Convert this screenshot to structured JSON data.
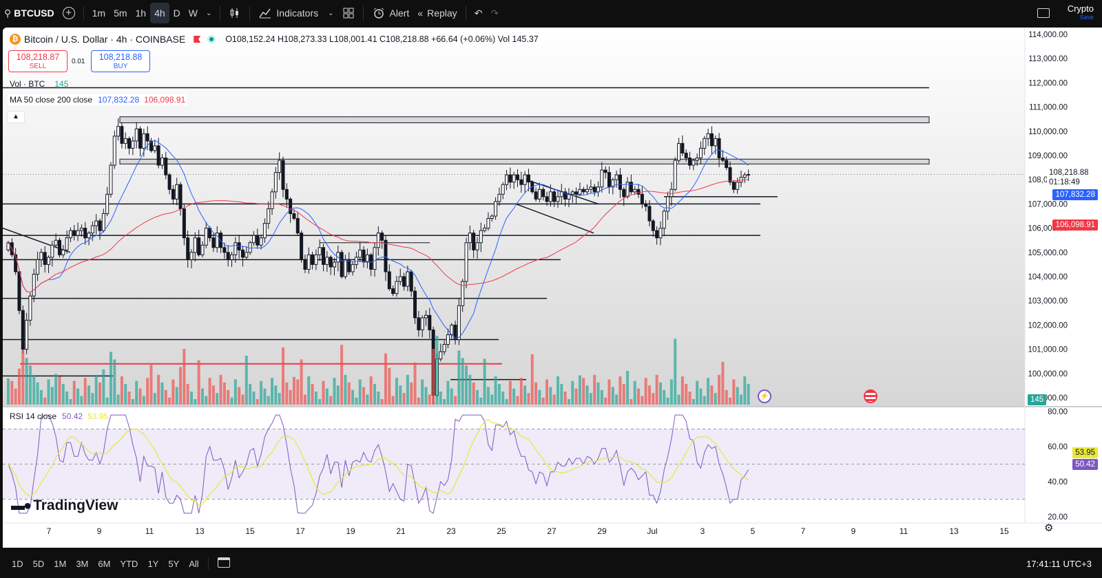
{
  "header": {
    "symbol": "BTCUSD",
    "intervals": [
      "1m",
      "5m",
      "1h",
      "4h",
      "D",
      "W"
    ],
    "active_interval": "4h",
    "indicators_label": "Indicators",
    "alert_label": "Alert",
    "replay_label": "Replay",
    "account_title": "Crypto",
    "account_sub": "Save"
  },
  "legend": {
    "title": "Bitcoin / U.S. Dollar · 4h · COINBASE",
    "ohlc": "O108,152.24 H108,273.33 L108,001.41 C108,218.88 +66.64 (+0.06%) Vol 145.37",
    "sell_price": "108,218.87",
    "sell_label": "SELL",
    "spread": "0.01",
    "buy_price": "108,218.88",
    "buy_label": "BUY",
    "vol_label": "Vol · BTC",
    "vol_value": "145",
    "ma_label": "MA 50 close 200 close",
    "ma50_value": "107,832.28",
    "ma200_value": "106,098.91",
    "rsi_label": "RSI 14 close",
    "rsi_value": "50.42",
    "rsi_ma_value": "53.95"
  },
  "price_axis": {
    "labels": [
      "114,000.00",
      "113,000.00",
      "112,000.00",
      "111,000.00",
      "110,000.00",
      "109,000.00",
      "108,000.00",
      "107,000.00",
      "106,000.00",
      "105,000.00",
      "104,000.00",
      "103,000.00",
      "102,000.00",
      "101,000.00",
      "100,000.00",
      "99,000.00"
    ],
    "last_price": "108,218.88",
    "countdown": "01:18:49",
    "ma50_tag": "107,832.28",
    "ma200_tag": "106,098.91",
    "vol_tag": "145"
  },
  "rsi_axis": {
    "labels": [
      "80.00",
      "60.00",
      "40.00",
      "20.00"
    ],
    "rsi_ma_tag": "53.95",
    "rsi_tag": "50.42"
  },
  "time_axis": {
    "labels": [
      "7",
      "9",
      "11",
      "13",
      "15",
      "17",
      "19",
      "21",
      "23",
      "25",
      "27",
      "29",
      "Jul",
      "3",
      "5",
      "7",
      "9",
      "11",
      "13",
      "15"
    ]
  },
  "watermark": "TradingView",
  "bottom": {
    "ranges": [
      "1D",
      "5D",
      "1M",
      "3M",
      "6M",
      "YTD",
      "1Y",
      "5Y",
      "All"
    ],
    "clock": "17:41:11 UTC+3"
  },
  "colors": {
    "up": "#26a69a",
    "down": "#ef5350",
    "ma50": "#2962ff",
    "ma200": "#f23645",
    "rsi": "#7e57c2",
    "rsi_ma": "#e8e83a"
  },
  "chart_data": {
    "type": "candlestick",
    "price_range": [
      99000,
      114000
    ],
    "closes": [
      105400,
      104900,
      104200,
      102600,
      101000,
      102200,
      103200,
      104100,
      104700,
      105000,
      104500,
      104800,
      105300,
      105500,
      104900,
      105100,
      105600,
      105900,
      105700,
      105900,
      106000,
      105600,
      105800,
      106100,
      106300,
      105900,
      106600,
      107400,
      108600,
      109800,
      110200,
      109500,
      109700,
      109300,
      109600,
      110100,
      109300,
      109900,
      109600,
      109200,
      109400,
      108600,
      108900,
      108200,
      107600,
      107200,
      107800,
      106800,
      105600,
      104700,
      105000,
      105600,
      104900,
      105300,
      106000,
      105600,
      105200,
      105800,
      105200,
      105000,
      104700,
      104900,
      105400,
      105100,
      104800,
      105000,
      105400,
      105700,
      105300,
      105600,
      106200,
      106800,
      107500,
      108300,
      108800,
      107600,
      107200,
      106600,
      106400,
      105800,
      104700,
      104300,
      104900,
      104500,
      104900,
      105200,
      104500,
      104800,
      104400,
      104600,
      105000,
      104000,
      104700,
      104200,
      104500,
      104800,
      105100,
      104600,
      104900,
      104300,
      105200,
      105800,
      105500,
      104200,
      103500,
      103300,
      103800,
      104000,
      103600,
      104200,
      103400,
      102300,
      101800,
      102300,
      102400,
      101800,
      99100,
      100600,
      100900,
      101200,
      101600,
      102000,
      101400,
      102800,
      103800,
      105400,
      105800,
      105100,
      105400,
      105900,
      106000,
      106400,
      106500,
      107100,
      107400,
      107800,
      108200,
      107900,
      108200,
      108000,
      107800,
      108200,
      107900,
      107500,
      107200,
      107600,
      107300,
      107100,
      107500,
      107100,
      107300,
      107500,
      107200,
      107400,
      107500,
      107400,
      107600,
      107500,
      107600,
      107700,
      107500,
      107700,
      108400,
      108300,
      107700,
      108000,
      108200,
      107600,
      107300,
      107900,
      107500,
      107600,
      107400,
      107000,
      106900,
      106300,
      105900,
      105600,
      106000,
      106700,
      107300,
      107600,
      108800,
      109500,
      109100,
      108900,
      108600,
      108800,
      108900,
      109300,
      109700,
      109900,
      109400,
      109700,
      108900,
      108800,
      108500,
      107900,
      107600,
      107900,
      108100,
      108200,
      108218
    ]
  }
}
